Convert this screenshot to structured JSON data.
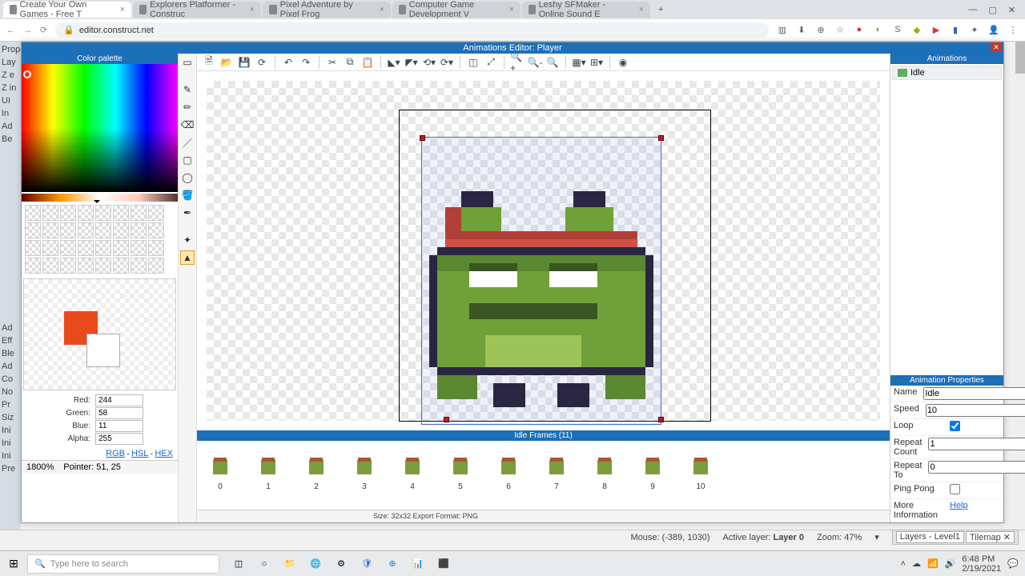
{
  "browser": {
    "tabs": [
      "Create Your Own Games - Free T",
      "Explorers Platformer - Construc",
      "Pixel Adventure by Pixel Frog",
      "Computer Game Development V",
      "Leshy SFMaker - Online Sound E"
    ],
    "url": "editor.construct.net"
  },
  "leftStrip": [
    "Prope",
    "Lay",
    "Z e",
    "Z in",
    "UI",
    "In",
    "Ad",
    "Be",
    "",
    "",
    "",
    "",
    "",
    "",
    "",
    "",
    "",
    "",
    "",
    "",
    "",
    "",
    "",
    "Ad",
    "Eff",
    "Ble",
    "Ad",
    "Co",
    "No",
    "Pr",
    "Siz",
    "Ini",
    "Ini",
    "Ini",
    "Pre"
  ],
  "moreInfoLabel": "More information",
  "helpLink": "Help",
  "window": {
    "title": "Animations Editor: Player",
    "colorPaletteTitle": "Color palette",
    "rgba": {
      "red": "244",
      "green": "58",
      "blue": "11",
      "alpha": "255"
    },
    "rgbLabels": {
      "r": "Red:",
      "g": "Green:",
      "b": "Blue:",
      "a": "Alpha:"
    },
    "colorModes": [
      "RGB",
      "HSL",
      "HEX"
    ],
    "zoom": "1800%",
    "pointer": "Pointer: 51, 25",
    "canvasStatus": "Size: 32x32    Export Format: PNG",
    "framesTitle": "Idle Frames (11)",
    "frames": [
      "0",
      "1",
      "2",
      "3",
      "4",
      "5",
      "6",
      "7",
      "8",
      "9",
      "10"
    ],
    "animationsTitle": "Animations",
    "animList": [
      "Idle"
    ],
    "animPropsTitle": "Animation Properties",
    "props": {
      "nameK": "Name",
      "nameV": "Idle",
      "speedK": "Speed",
      "speedV": "10",
      "loopK": "Loop",
      "repeatCountK": "Repeat Count",
      "repeatCountV": "1",
      "repeatToK": "Repeat To",
      "repeatToV": "0",
      "pingPongK": "Ping Pong",
      "moreK": "More Information",
      "moreV": "Help"
    }
  },
  "statusBar": {
    "mouse": "Mouse: (-389, 1030)",
    "layer": "Active layer: ",
    "layerName": "Layer 0",
    "zoom": "Zoom: 47%",
    "tabs": [
      "Layers - Level1",
      "Tilemap ✕"
    ]
  },
  "taskbar": {
    "search": "Type here to search",
    "time": "6:48 PM",
    "date": "2/19/2021"
  }
}
